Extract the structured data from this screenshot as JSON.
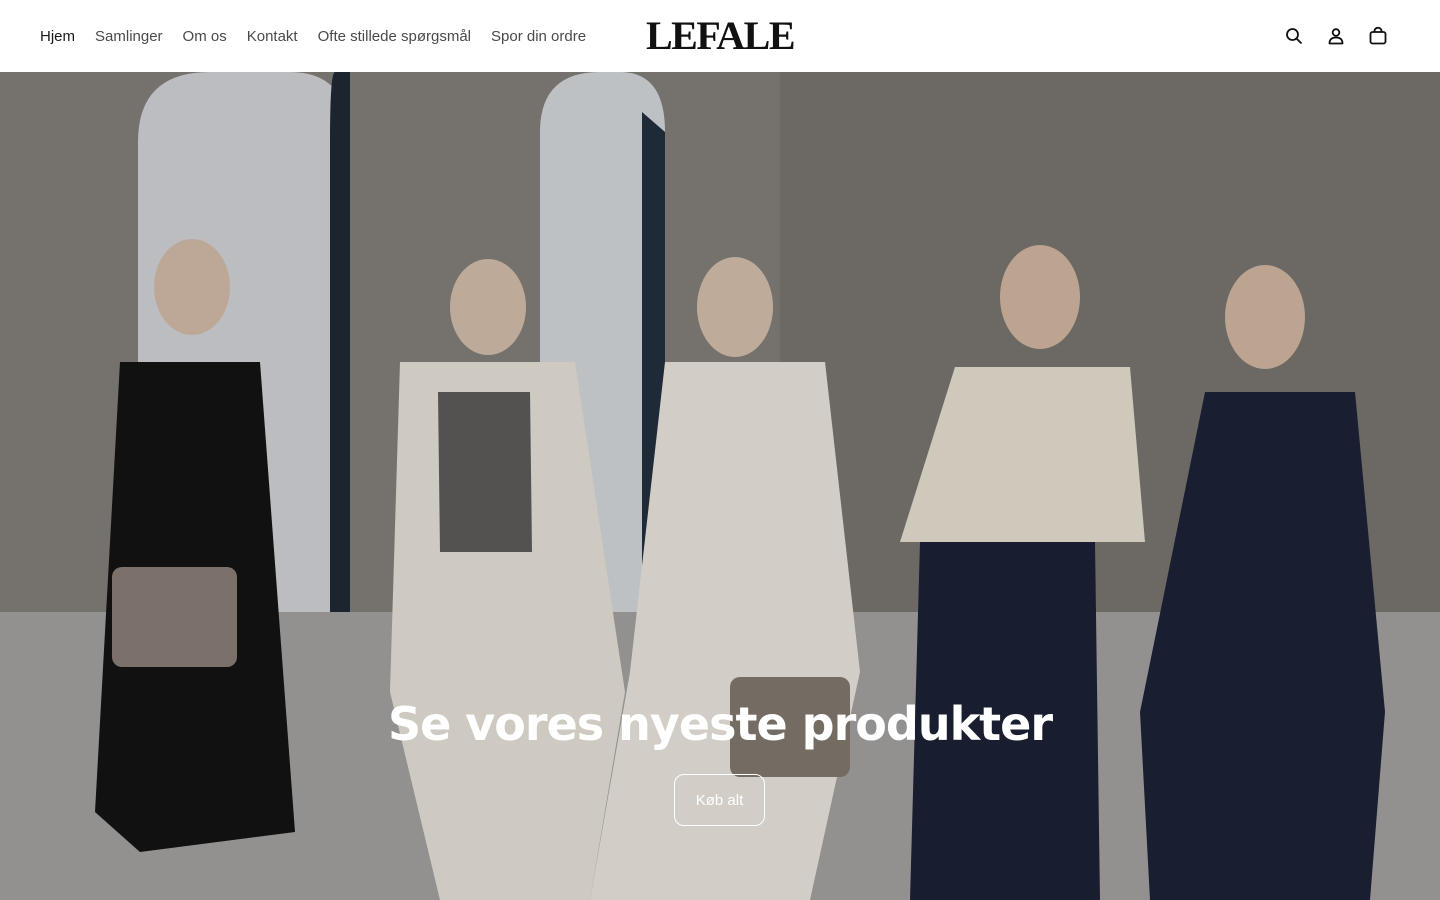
{
  "header": {
    "brand": "LEFALE",
    "nav": [
      {
        "label": "Hjem"
      },
      {
        "label": "Samlinger"
      },
      {
        "label": "Om os"
      },
      {
        "label": "Kontakt"
      },
      {
        "label": "Ofte stillede spørgsmål"
      },
      {
        "label": "Spor din ordre"
      }
    ],
    "icons": [
      "search-icon",
      "account-icon",
      "cart-icon"
    ]
  },
  "hero": {
    "title": "Se vores nyeste produkter",
    "cta_label": "Køb alt"
  },
  "colors": {
    "text_dark": "#1a1a1a",
    "nav_text": "#4a4a4a",
    "hero_text": "#ffffff"
  }
}
